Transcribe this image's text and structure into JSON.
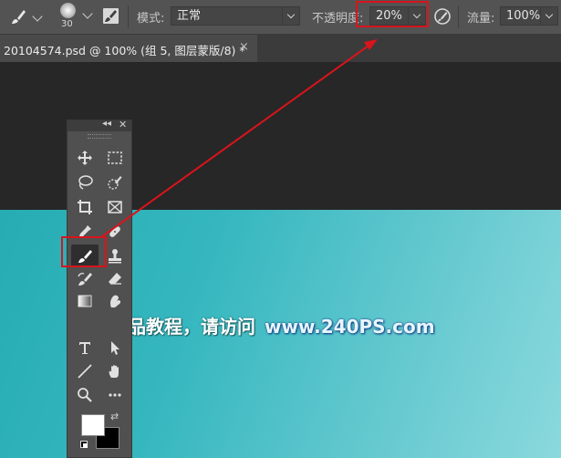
{
  "options_bar": {
    "brush_size": "30",
    "mode_label": "模式:",
    "mode_value": "正常",
    "opacity_label": "不透明度:",
    "opacity_value": "20%",
    "flow_label": "流量:",
    "flow_value": "100%"
  },
  "document_tab": {
    "title": "20104574.psd @ 100% (组 5, 图层蒙版/8) *",
    "close": "×"
  },
  "toolbox": {
    "header_collapse": "◂◂",
    "header_close": "✕",
    "tools": [
      "move",
      "marquee",
      "lasso",
      "quick-select",
      "crop",
      "frame",
      "eyedropper",
      "healing-brush",
      "brush",
      "clone-stamp",
      "history-brush",
      "eraser",
      "gradient",
      "smudge",
      "type",
      "path-select",
      "line",
      "hand",
      "zoom",
      "more"
    ],
    "selected_tool": "brush",
    "foreground_color": "#ffffff",
    "background_color": "#000000"
  },
  "watermark": {
    "text": "更多精品教程，请访问",
    "url": "www.240PS.com"
  },
  "colors": {
    "annotation": "#d8141c",
    "canvas_teal": "#36b7bf"
  }
}
